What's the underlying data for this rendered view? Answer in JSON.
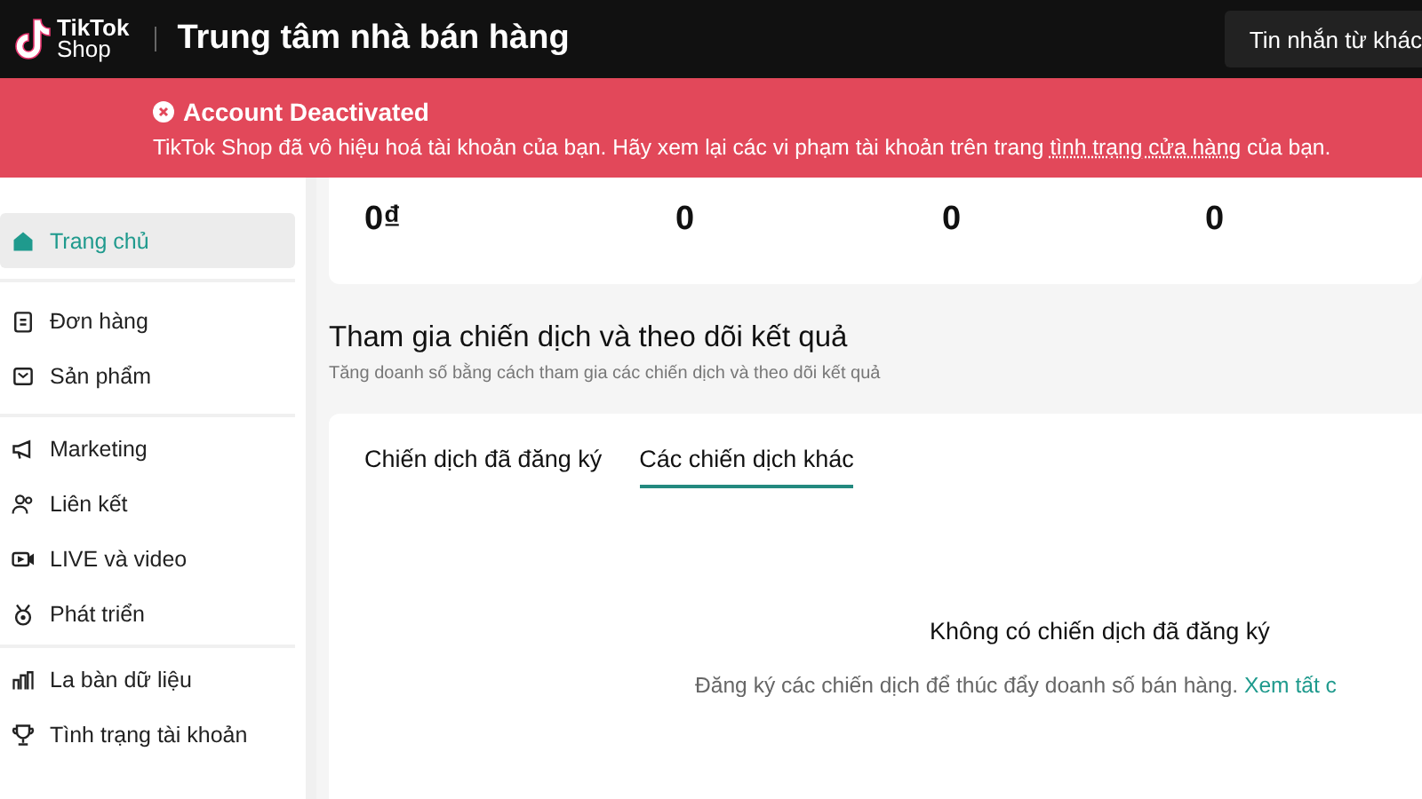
{
  "header": {
    "logo_line1": "TikTok",
    "logo_line2": "Shop",
    "title": "Trung tâm nhà bán hàng",
    "message_button": "Tin nhắn từ khác"
  },
  "banner": {
    "title": "Account Deactivated",
    "text_before": "TikTok Shop đã vô hiệu hoá tài khoản của bạn. Hãy xem lại các vi phạm tài khoản trên trang ",
    "link": "tình trạng cửa hàng",
    "text_after": " của bạn."
  },
  "sidebar": {
    "groups": [
      [
        {
          "label": "Trang chủ",
          "selected": true
        }
      ],
      [
        {
          "label": "Đơn hàng",
          "selected": false
        },
        {
          "label": "Sản phẩm",
          "selected": false
        }
      ],
      [
        {
          "label": "Marketing",
          "selected": false
        },
        {
          "label": "Liên kết",
          "selected": false
        },
        {
          "label": "LIVE và video",
          "selected": false
        },
        {
          "label": "Phát triển",
          "selected": false
        }
      ],
      [
        {
          "label": "La bàn dữ liệu",
          "selected": false
        },
        {
          "label": "Tình trạng tài khoản",
          "selected": false
        }
      ]
    ]
  },
  "stats": [
    "0₫",
    "0",
    "0",
    "0"
  ],
  "campaigns": {
    "title": "Tham gia chiến dịch và theo dõi kết quả",
    "subtitle": "Tăng doanh số bằng cách tham gia các chiến dịch và theo dõi kết quả",
    "tabs": [
      {
        "label": "Chiến dịch đã đăng ký",
        "selected": false
      },
      {
        "label": "Các chiến dịch khác",
        "selected": true
      }
    ],
    "empty_title": "Không có chiến dịch đã đăng ký",
    "empty_text": "Đăng ký các chiến dịch để thúc đẩy doanh số bán hàng.",
    "empty_link": "Xem tất c"
  }
}
